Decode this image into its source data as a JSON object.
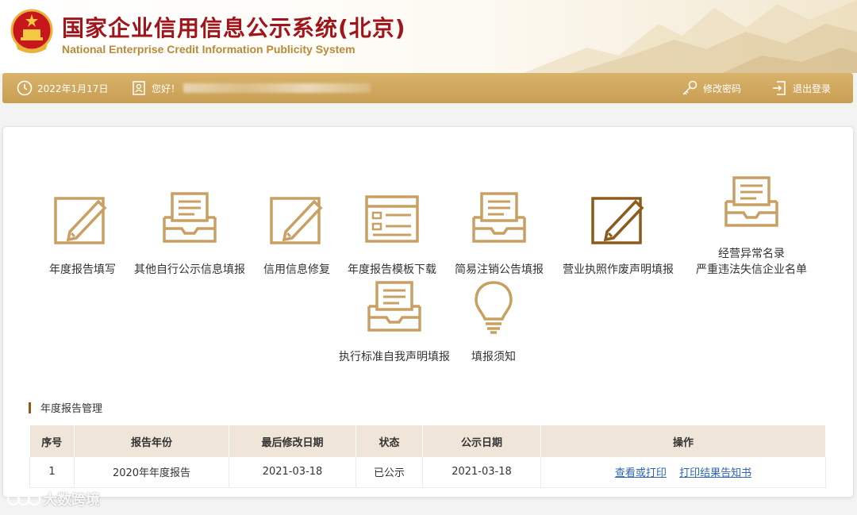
{
  "header": {
    "title_cn": "国家企业信用信息公示系统(北京)",
    "title_en": "National Enterprise Credit Information Publicity System"
  },
  "topbar": {
    "date": "2022年1月17日",
    "greeting": "您好！",
    "change_password": "修改密码",
    "logout": "退出登录"
  },
  "tiles": [
    {
      "label": "年度报告填写",
      "icon": "edit-icon"
    },
    {
      "label": "其他自行公示信息填报",
      "icon": "inbox-icon"
    },
    {
      "label": "信用信息修复",
      "icon": "edit-icon"
    },
    {
      "label": "年度报告模板下载",
      "icon": "template-icon"
    },
    {
      "label": "简易注销公告填报",
      "icon": "inbox-icon"
    },
    {
      "label": "营业执照作废声明填报",
      "icon": "edit-icon"
    },
    {
      "label": "经营异常名录",
      "label2": "严重违法失信企业名单",
      "icon": "inbox-icon"
    },
    {
      "label": "执行标准自我声明填报",
      "icon": "inbox-icon"
    },
    {
      "label": "填报须知",
      "icon": "lightbulb-icon"
    }
  ],
  "annual_report": {
    "section_title": "年度报告管理",
    "columns": [
      "序号",
      "报告年份",
      "最后修改日期",
      "状态",
      "公示日期",
      "操作"
    ],
    "rows": [
      {
        "no": "1",
        "year": "2020年年度报告",
        "modified": "2021-03-18",
        "status": "已公示",
        "published": "2021-03-18",
        "action1": "查看或打印",
        "action2": "打印结果告知书"
      }
    ]
  },
  "watermark": "大数跨境",
  "colors": {
    "brand_red": "#a0151b",
    "gold": "#c89e54",
    "icon_gold": "#c9a063",
    "link": "#2d64b3"
  }
}
